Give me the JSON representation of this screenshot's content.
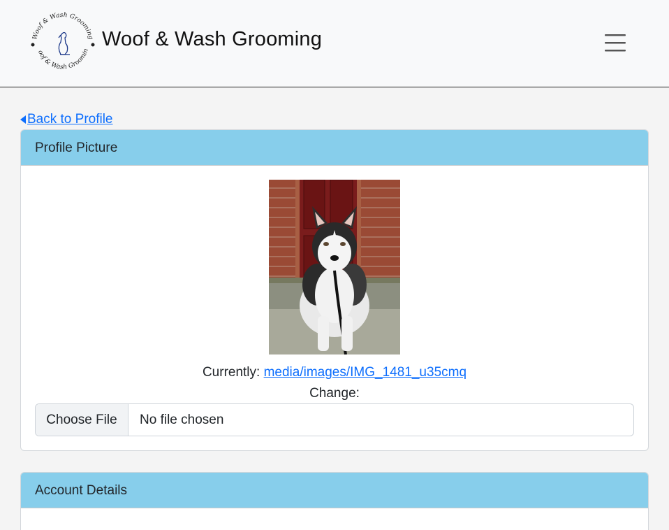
{
  "navbar": {
    "brand": "Woof & Wash Grooming",
    "logo_text": "Woof & Wash Grooming",
    "menu_icon": "hamburger-menu-icon"
  },
  "back_link": {
    "label": "Back to Profile",
    "icon": "caret-left-icon"
  },
  "profile_picture_card": {
    "title": "Profile Picture",
    "image_alt": "husky dog sitting on doorstep",
    "currently_label": "Currently:",
    "current_file": "media/images/IMG_1481_u35cmq",
    "change_label": "Change:",
    "file_button": "Choose File",
    "file_status": "No file chosen"
  },
  "account_details_card": {
    "title": "Account Details"
  },
  "colors": {
    "card_header": "#87ceeb",
    "link": "#0d6efd",
    "navbar_bg": "#f8f9fa",
    "page_bg": "#f4f4f4"
  }
}
